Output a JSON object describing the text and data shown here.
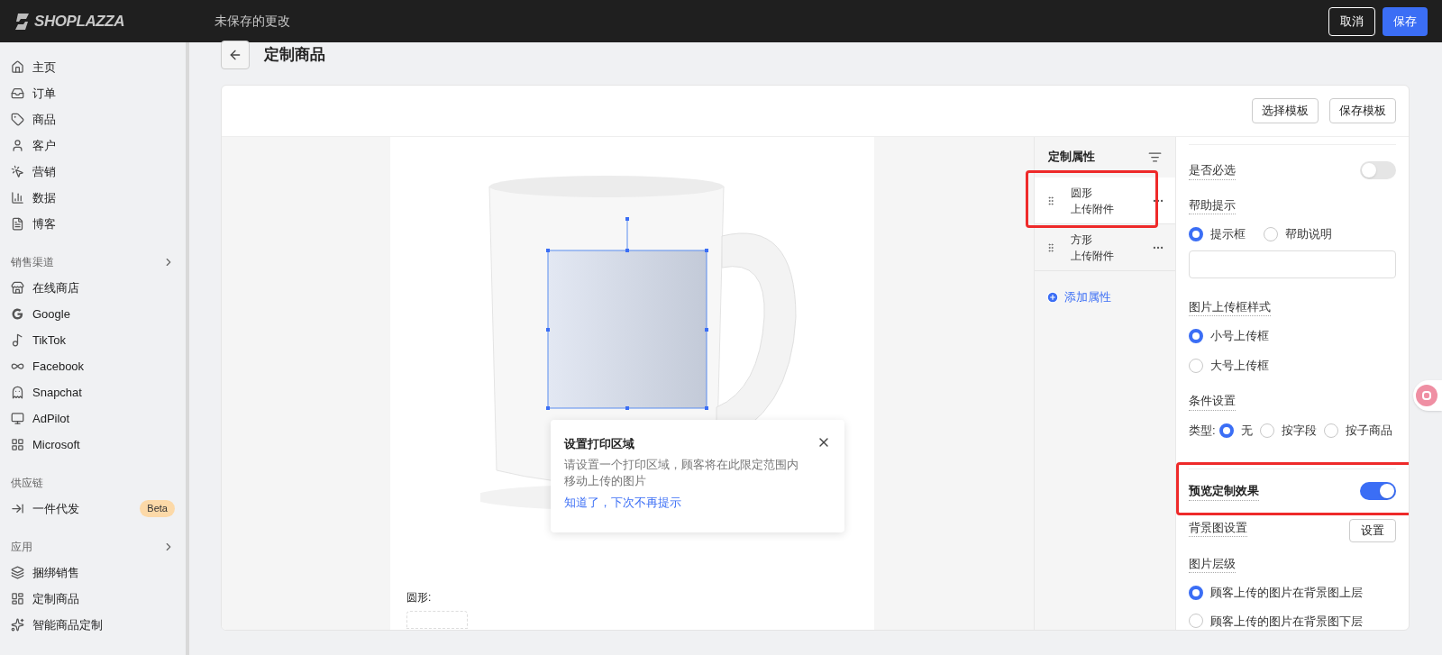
{
  "topbar": {
    "logo": "SHOPLAZZA",
    "status": "未保存的更改",
    "buttons": [
      {
        "label": "取消",
        "kind": "secondary"
      },
      {
        "label": "保存",
        "kind": "primary"
      }
    ]
  },
  "sidebar": {
    "sections": [
      {
        "items": [
          {
            "label": "主页"
          },
          {
            "label": "订单"
          },
          {
            "label": "商品"
          },
          {
            "label": "客户"
          },
          {
            "label": "营销"
          },
          {
            "label": "数据"
          },
          {
            "label": "博客"
          }
        ]
      },
      {
        "title": "销售渠道",
        "expandable": true,
        "items": [
          {
            "label": "在线商店"
          },
          {
            "label": "Google"
          },
          {
            "label": "TikTok"
          },
          {
            "label": "Facebook"
          },
          {
            "label": "Snapchat"
          },
          {
            "label": "AdPilot"
          },
          {
            "label": "Microsoft"
          }
        ]
      },
      {
        "title": "供应链",
        "expandable": false,
        "items": [
          {
            "label": "一件代发",
            "badge": "Beta"
          }
        ]
      },
      {
        "title": "应用",
        "expandable": true,
        "items": [
          {
            "label": "捆绑销售"
          },
          {
            "label": "定制商品"
          },
          {
            "label": "智能商品定制"
          }
        ]
      }
    ]
  },
  "page": {
    "title": "定制商品",
    "toolbar_buttons": [
      "选择模板",
      "保存模板"
    ]
  },
  "canvas": {
    "popover": {
      "title": "设置打印区域",
      "body": "请设置一个打印区域，顾客将在此限定范围内移动上传的图片",
      "link": "知道了，下次不再提示"
    },
    "field_label": "圆形:"
  },
  "attributes": {
    "title": "定制属性",
    "items": [
      {
        "shape": "圆形",
        "type": "上传附件",
        "selected": true,
        "highlighted": true
      },
      {
        "shape": "方形",
        "type": "上传附件",
        "selected": false,
        "highlighted": false
      }
    ],
    "add": "添加属性"
  },
  "settings": {
    "required": {
      "label": "是否必选",
      "on": false
    },
    "help": {
      "label": "帮助提示",
      "options": [
        {
          "label": "提示框",
          "selected": true
        },
        {
          "label": "帮助说明",
          "selected": false
        }
      ]
    },
    "upload_style": {
      "label": "图片上传框样式",
      "options": [
        {
          "label": "小号上传框",
          "selected": true
        },
        {
          "label": "大号上传框",
          "selected": false
        }
      ]
    },
    "conditions": {
      "label": "条件设置",
      "type_label": "类型:",
      "options": [
        {
          "label": "无",
          "selected": true
        },
        {
          "label": "按字段",
          "selected": false
        },
        {
          "label": "按子商品",
          "selected": false
        }
      ]
    },
    "preview": {
      "label": "预览定制效果",
      "on": true,
      "highlighted": true
    },
    "background": {
      "label": "背景图设置",
      "button": "设置"
    },
    "layer": {
      "label": "图片层级",
      "options": [
        {
          "label": "顾客上传的图片在背景图上层",
          "selected": true
        },
        {
          "label": "顾客上传的图片在背景图下层",
          "selected": false
        }
      ]
    }
  }
}
